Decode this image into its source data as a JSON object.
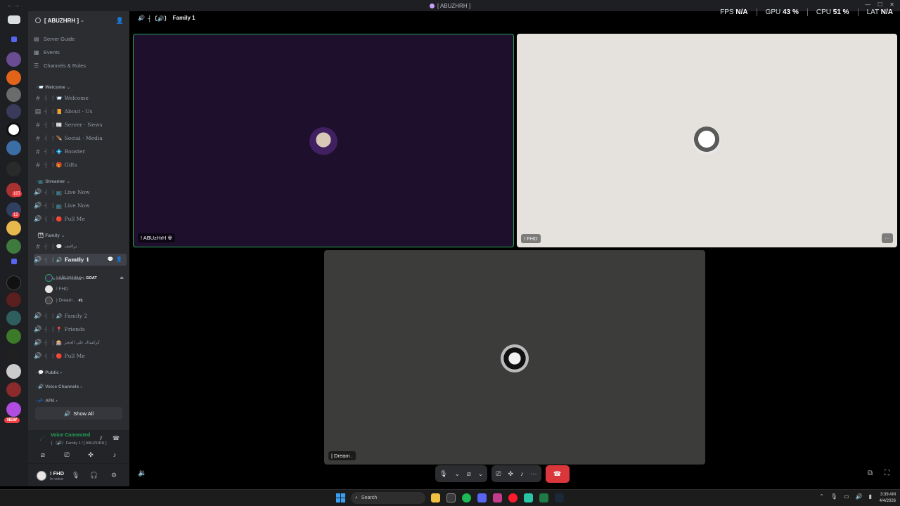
{
  "window": {
    "title": "[ ABUZHRH ]",
    "title_prefix": "•"
  },
  "server": {
    "name": "[ ABUZHRH ]",
    "chevron": "⌄"
  },
  "nav": [
    {
      "label": "Server Guide"
    },
    {
      "label": "Events"
    },
    {
      "label": "Channels & Roles"
    }
  ],
  "categories": {
    "welcome": "Welcome",
    "streamer": "Streamer",
    "family": "Family",
    "public": "Public",
    "voice": "Voice Channels",
    "afk": "AFK"
  },
  "channels": [
    {
      "label": "Welcome"
    },
    {
      "label": "About · Us"
    },
    {
      "label": "Server · News"
    },
    {
      "label": "Social · Media"
    },
    {
      "label": "Booster"
    },
    {
      "label": "Gifts"
    },
    {
      "label": "Live Now"
    },
    {
      "label": "Live Now"
    },
    {
      "label": "Pull Me"
    },
    {
      "label": "براغيف"
    },
    {
      "label": "Family 1"
    },
    {
      "label": "Family 2"
    },
    {
      "label": "Friends"
    },
    {
      "label": "كركساك على الحجر"
    },
    {
      "label": "Pull Me"
    }
  ],
  "channel_status": "Set a channel status",
  "voice_users": [
    {
      "name": "! ABUzHrH",
      "tag": "GOAT"
    },
    {
      "name": "! FHD",
      "tag": ""
    },
    {
      "name": "| Dream .",
      "tag": "#1"
    }
  ],
  "show_all": "Show All",
  "voice_panel": {
    "status": "Voice Connected",
    "channel": "Family 1 / [ ABUZHRH ]"
  },
  "user": {
    "name": "! FHD",
    "status": "In voice"
  },
  "call": {
    "channel": "Family 1"
  },
  "perf": {
    "fps_label": "FPS",
    "fps_value": "N/A",
    "gpu_label": "GPU",
    "gpu_value": "43 %",
    "cpu_label": "CPU",
    "cpu_value": "51 %",
    "lat_label": "LAT",
    "lat_value": "N/A"
  },
  "tiles": [
    {
      "name": "! ABUzHrH",
      "bg": "#1e0f2d"
    },
    {
      "name": "! FHD",
      "bg": "#e5e2de"
    },
    {
      "name": "| Dream .",
      "bg": "#3c3d3a"
    }
  ],
  "taskbar": {
    "search": "Search",
    "time": "3:39 AM",
    "date": "4/4/2026"
  },
  "colors": {
    "accent_green": "#23a55a",
    "hangup_red": "#da373c",
    "sidebar": "#2b2d31",
    "rail": "#1e1f22"
  }
}
